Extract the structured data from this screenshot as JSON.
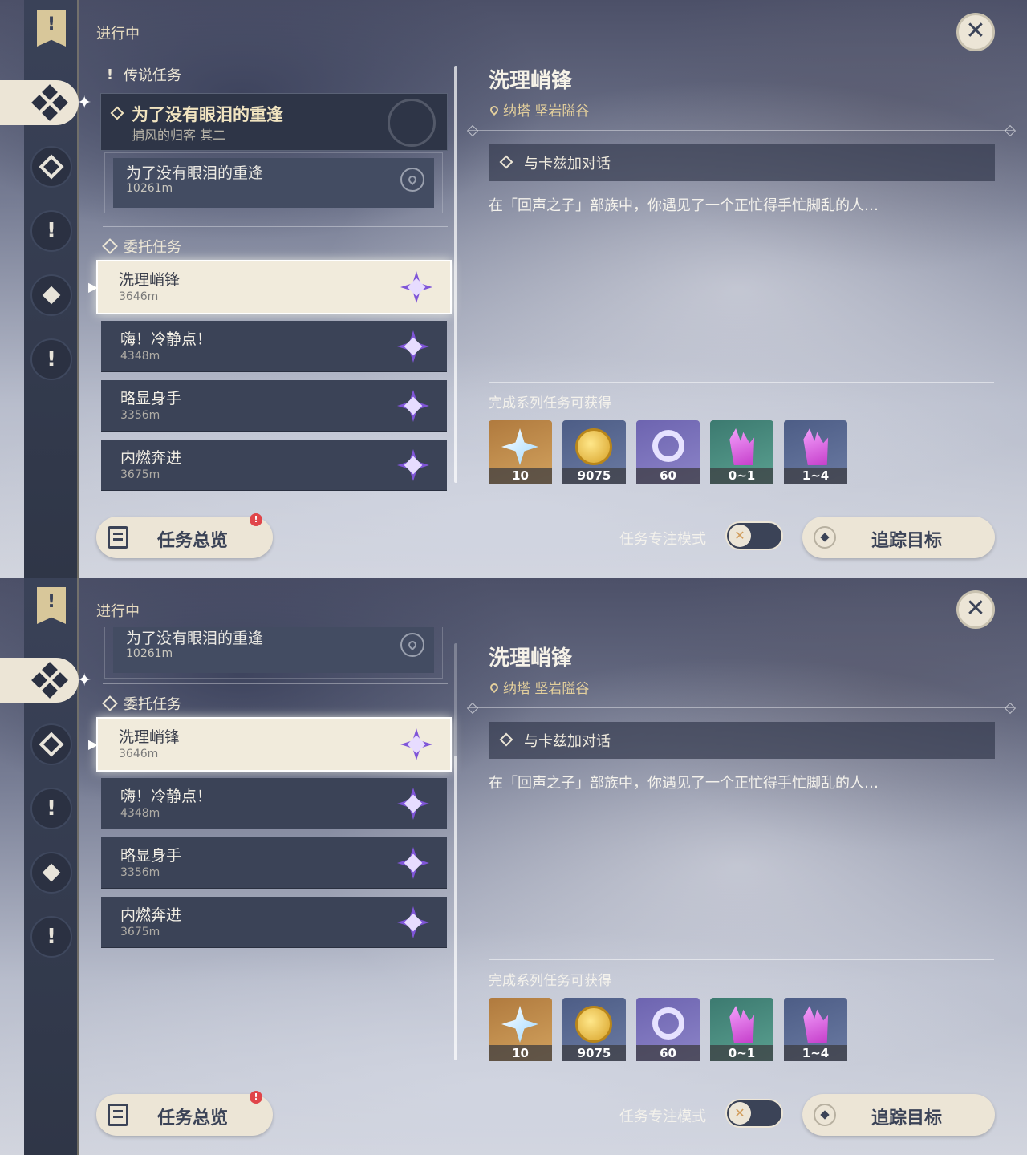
{
  "header": {
    "in_progress": "进行中"
  },
  "sections": {
    "legend": "传说任务",
    "commission": "委托任务"
  },
  "legend_quest": {
    "title": "为了没有眼泪的重逢",
    "subtitle": "捕风的归客 其二"
  },
  "legend_sub": {
    "title": "为了没有眼泪的重逢",
    "distance": "10261m"
  },
  "quests": [
    {
      "title": "洗理峭锋",
      "distance": "3646m",
      "selected": true
    },
    {
      "title": "嗨！冷静点！",
      "distance": "4348m",
      "selected": false
    },
    {
      "title": "略显身手",
      "distance": "3356m",
      "selected": false
    },
    {
      "title": "内燃奔进",
      "distance": "3675m",
      "selected": false
    }
  ],
  "detail": {
    "title": "洗理峭锋",
    "location": "纳塔 坚岩隘谷",
    "objective": "与卡兹加对话",
    "description": "在「回声之子」部族中，你遇见了一个正忙得手忙脚乱的人…",
    "rewards_label": "完成系列任务可获得",
    "rewards": [
      {
        "icon": "primogem-icon",
        "count": "10"
      },
      {
        "icon": "mora-icon",
        "count": "9075"
      },
      {
        "icon": "adventure-exp-icon",
        "count": "60"
      },
      {
        "icon": "crystal-icon",
        "count": "0~1"
      },
      {
        "icon": "crystal-cluster-icon",
        "count": "1~4"
      }
    ]
  },
  "footer": {
    "overview": "任务总览",
    "badge": "!",
    "focus_mode": "任务专注模式",
    "track": "追踪目标"
  },
  "colors": {
    "accent": "#ece5d6",
    "rail": "#3a4258",
    "badge_red": "#e0454a",
    "quest_star": "#7f55d8"
  }
}
